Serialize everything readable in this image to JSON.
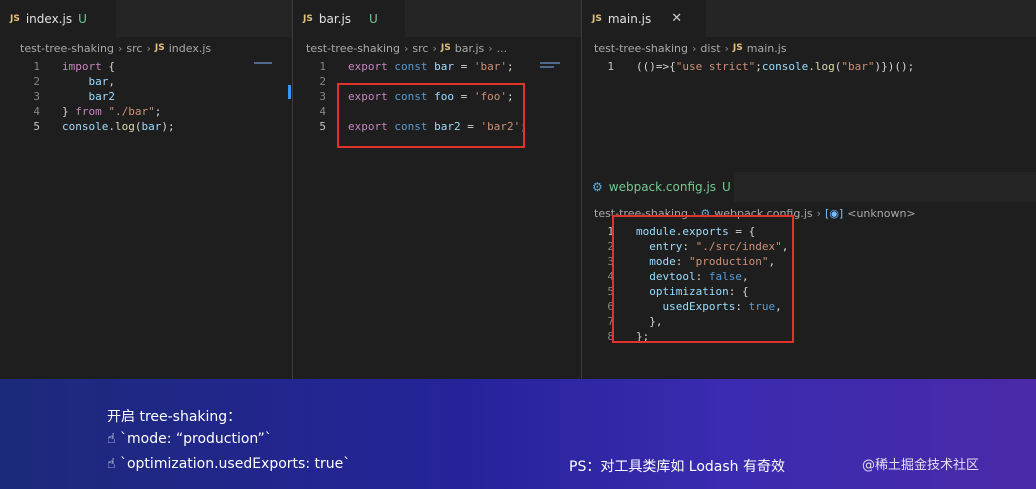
{
  "pane1": {
    "tab": {
      "icon": "JS",
      "label": "index.js",
      "badge": "U"
    },
    "breadcrumb": [
      "test-tree-shaking",
      "src",
      "index.js"
    ],
    "lines": [
      {
        "n": "1",
        "tokens": [
          [
            "kw",
            "import"
          ],
          [
            "plain",
            " {"
          ]
        ]
      },
      {
        "n": "2",
        "tokens": [
          [
            "plain",
            "    "
          ],
          [
            "var",
            "bar"
          ],
          [
            "plain",
            ","
          ]
        ]
      },
      {
        "n": "3",
        "tokens": [
          [
            "plain",
            "    "
          ],
          [
            "var",
            "bar2"
          ]
        ]
      },
      {
        "n": "4",
        "tokens": [
          [
            "plain",
            "} "
          ],
          [
            "kw",
            "from"
          ],
          [
            "plain",
            " "
          ],
          [
            "str",
            "\"./bar\""
          ],
          [
            "plain",
            ";"
          ]
        ]
      },
      {
        "n": "5",
        "tokens": [
          [
            "var",
            "console"
          ],
          [
            "plain",
            "."
          ],
          [
            "fn",
            "log"
          ],
          [
            "plain",
            "("
          ],
          [
            "var",
            "bar"
          ],
          [
            "plain",
            ");"
          ]
        ]
      }
    ]
  },
  "pane2": {
    "tab": {
      "icon": "JS",
      "label": "bar.js",
      "badge": "U"
    },
    "breadcrumb": [
      "test-tree-shaking",
      "src",
      "bar.js",
      "..."
    ],
    "lines": [
      {
        "n": "1",
        "tokens": [
          [
            "kw",
            "export"
          ],
          [
            "plain",
            " "
          ],
          [
            "kw2",
            "const"
          ],
          [
            "plain",
            " "
          ],
          [
            "var",
            "bar"
          ],
          [
            "plain",
            " = "
          ],
          [
            "str",
            "'bar'"
          ],
          [
            "plain",
            ";"
          ]
        ]
      },
      {
        "n": "2",
        "tokens": []
      },
      {
        "n": "3",
        "tokens": [
          [
            "kw",
            "export"
          ],
          [
            "plain",
            " "
          ],
          [
            "kw2",
            "const"
          ],
          [
            "plain",
            " "
          ],
          [
            "var",
            "foo"
          ],
          [
            "plain",
            " = "
          ],
          [
            "str",
            "'foo'"
          ],
          [
            "plain",
            ";"
          ]
        ]
      },
      {
        "n": "4",
        "tokens": []
      },
      {
        "n": "5",
        "tokens": [
          [
            "kw",
            "export"
          ],
          [
            "plain",
            " "
          ],
          [
            "kw2",
            "const"
          ],
          [
            "plain",
            " "
          ],
          [
            "var",
            "bar2"
          ],
          [
            "plain",
            " = "
          ],
          [
            "str",
            "'bar2'"
          ],
          [
            "plain",
            ";"
          ]
        ]
      }
    ]
  },
  "pane3": {
    "tab": {
      "icon": "JS",
      "label": "main.js",
      "close": "✕"
    },
    "breadcrumb": [
      "test-tree-shaking",
      "dist",
      "main.js"
    ],
    "lines": [
      {
        "n": "1",
        "tokens": [
          [
            "plain",
            "(()=>{"
          ],
          [
            "str",
            "\"use strict\""
          ],
          [
            "plain",
            ";"
          ],
          [
            "var",
            "console"
          ],
          [
            "plain",
            "."
          ],
          [
            "fn",
            "log"
          ],
          [
            "plain",
            "("
          ],
          [
            "str",
            "\"bar\""
          ],
          [
            "plain",
            ")})();"
          ]
        ]
      }
    ]
  },
  "pane4": {
    "tab": {
      "icon": "⚙",
      "label": "webpack.config.js",
      "badge": "U"
    },
    "breadcrumb": [
      "test-tree-shaking",
      "webpack.config.js",
      "<unknown>"
    ],
    "lines": [
      {
        "n": "1",
        "tokens": [
          [
            "var",
            "module"
          ],
          [
            "plain",
            "."
          ],
          [
            "var",
            "exports"
          ],
          [
            "plain",
            " = {"
          ]
        ]
      },
      {
        "n": "2",
        "tokens": [
          [
            "plain",
            "  "
          ],
          [
            "var",
            "entry"
          ],
          [
            "plain",
            ": "
          ],
          [
            "str",
            "\"./src/index\""
          ],
          [
            "plain",
            ","
          ]
        ]
      },
      {
        "n": "3",
        "tokens": [
          [
            "plain",
            "  "
          ],
          [
            "var",
            "mode"
          ],
          [
            "plain",
            ": "
          ],
          [
            "str",
            "\"production\""
          ],
          [
            "plain",
            ","
          ]
        ]
      },
      {
        "n": "4",
        "tokens": [
          [
            "plain",
            "  "
          ],
          [
            "var",
            "devtool"
          ],
          [
            "plain",
            ": "
          ],
          [
            "kw2",
            "false"
          ],
          [
            "plain",
            ","
          ]
        ]
      },
      {
        "n": "5",
        "tokens": [
          [
            "plain",
            "  "
          ],
          [
            "var",
            "optimization"
          ],
          [
            "plain",
            ": {"
          ]
        ]
      },
      {
        "n": "6",
        "tokens": [
          [
            "plain",
            "    "
          ],
          [
            "var",
            "usedExports"
          ],
          [
            "plain",
            ": "
          ],
          [
            "kw2",
            "true"
          ],
          [
            "plain",
            ","
          ]
        ]
      },
      {
        "n": "7",
        "tokens": [
          [
            "plain",
            "  },"
          ]
        ]
      },
      {
        "n": "8",
        "tokens": [
          [
            "plain",
            "};"
          ]
        ]
      }
    ]
  },
  "caption": {
    "heading": "开启 tree-shaking：",
    "point1": "`mode: “production”`",
    "point2": "`optimization.usedExports: true`",
    "ps": "PS：对工具类库如 Lodash 有奇效",
    "watermark": "@稀土掘金技术社区"
  },
  "colors": {
    "highlight": "#e0342a",
    "accent": "#3794ff"
  }
}
